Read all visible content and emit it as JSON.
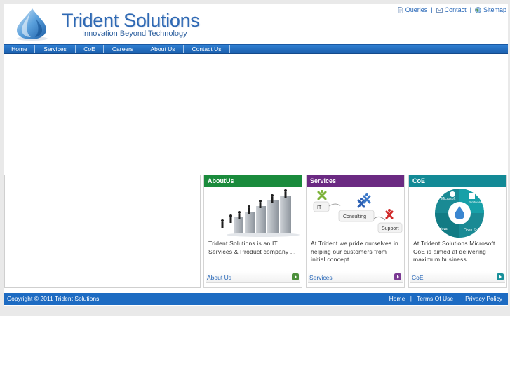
{
  "brand": {
    "name": "Trident Solutions",
    "tagline": "Innovation Beyond Technology"
  },
  "top_links": [
    {
      "label": "Queries",
      "icon": "document-icon"
    },
    {
      "label": "Contact",
      "icon": "envelope-icon"
    },
    {
      "label": "Sitemap",
      "icon": "globe-icon"
    }
  ],
  "top_separator": "|",
  "nav": [
    {
      "label": "Home"
    },
    {
      "label": "Services"
    },
    {
      "label": "CoE"
    },
    {
      "label": "Careers"
    },
    {
      "label": "About Us"
    },
    {
      "label": "Contact Us"
    }
  ],
  "panels": [
    {
      "title": "AboutUs",
      "color": "#1a8b3c",
      "text": "Trident Solutions is an IT Services & Product company ...",
      "link": "About Us",
      "image": "business-people-climbing-bar-chart"
    },
    {
      "title": "Services",
      "color": "#6b2a82",
      "text": "At Trident we pride ourselves in helping our customers from initial concept ...",
      "link": "Services",
      "image": "it-consulting-support-diagram",
      "image_labels": [
        "IT",
        "Consulting",
        "Support"
      ]
    },
    {
      "title": "CoE",
      "color": "#138a96",
      "text": "At Trident Solutions Microsoft CoE is aimed at delivering maximum business ...",
      "link": "CoE",
      "image": "coe-ring-diagram",
      "image_labels": [
        "Microsoft",
        "Software Testing",
        "Java",
        "Open Source"
      ]
    }
  ],
  "footer": {
    "copyright": "Copyright © 2011 Trident Solutions",
    "links": [
      "Home",
      "Terms Of Use",
      "Privacy Policy"
    ],
    "separator": "|"
  },
  "colors": {
    "nav_blue": "#1f67b8",
    "link_blue": "#2364b6",
    "footer_blue": "#1d6bc2",
    "outer_gray": "#e9e9e9"
  }
}
